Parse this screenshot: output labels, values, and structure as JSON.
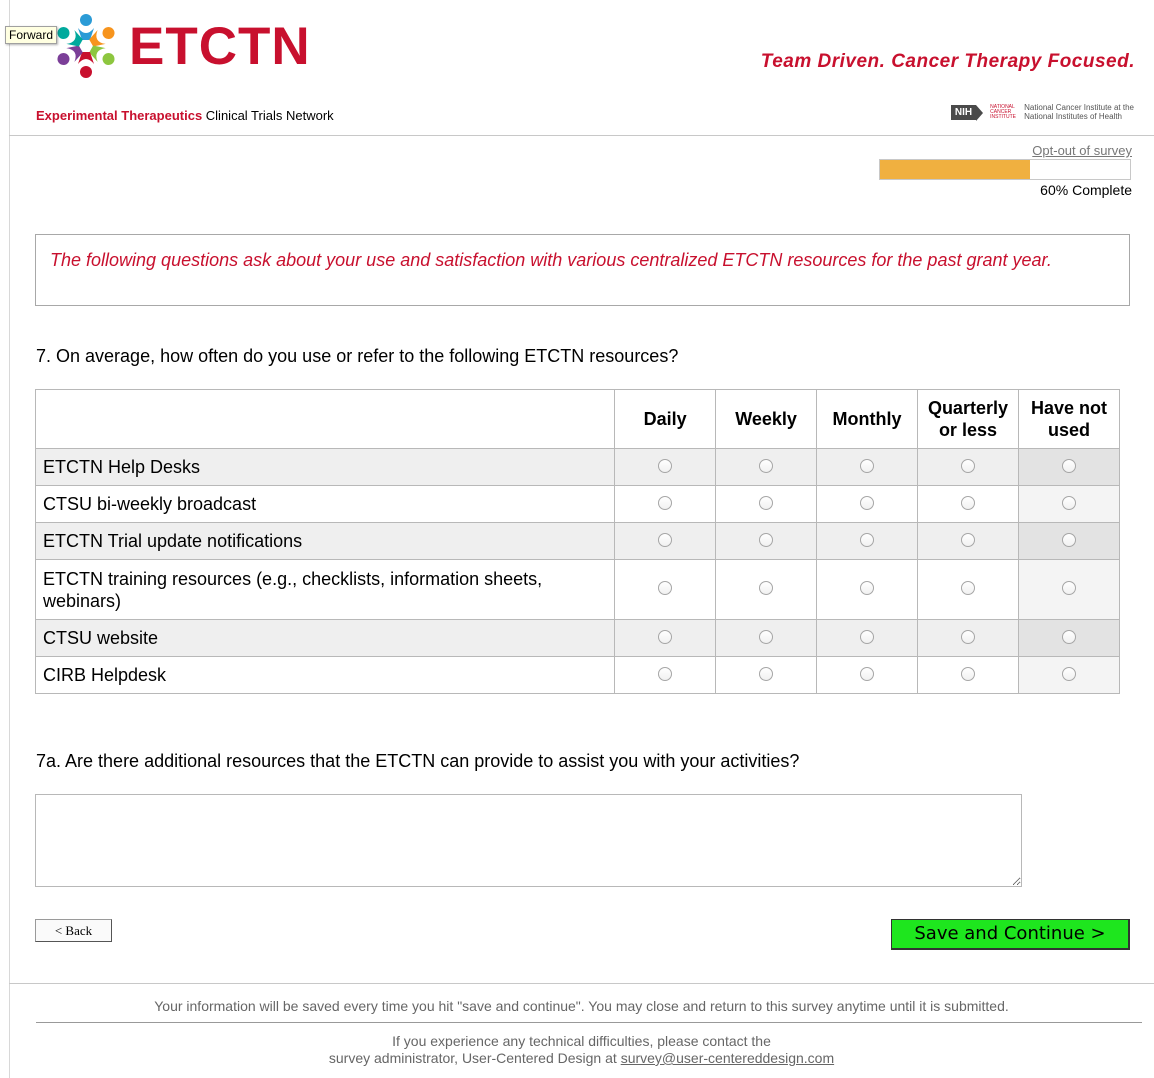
{
  "header": {
    "logo_text": "ETCTN",
    "tooltip": "Forward",
    "tagline": "Team Driven. Cancer Therapy Focused.",
    "network_red": "Experimental Therapeutics",
    "network_rest": " Clinical Trials Network",
    "nih_logo": "NIH",
    "nci_small": "NATIONAL CANCER INSTITUTE",
    "nih_line1": "National Cancer Institute at the",
    "nih_line2": "National Institutes of Health",
    "brand_color": "#c8102e"
  },
  "progress": {
    "optout": "Opt-out of survey",
    "percent": 60,
    "label": "60% Complete",
    "fill_color": "#f0b040"
  },
  "intro": "The following questions ask about your use and satisfaction with various centralized ETCTN resources for the past grant year.",
  "q7": {
    "question": "7. On average, how often do you use or refer to the following ETCTN resources?",
    "columns": [
      "Daily",
      "Weekly",
      "Monthly",
      "Quarterly or less",
      "Have not used"
    ],
    "rows": [
      "ETCTN Help Desks",
      "CTSU bi-weekly broadcast",
      "ETCTN Trial update notifications",
      "ETCTN training resources (e.g., checklists, information sheets, webinars)",
      "CTSU website",
      "CIRB Helpdesk"
    ]
  },
  "q7a": {
    "question": "7a. Are there additional resources that the ETCTN can provide to assist you with your activities?",
    "value": ""
  },
  "buttons": {
    "back": "< Back",
    "save": "Save and Continue >",
    "save_color": "#1ee61e"
  },
  "footer": {
    "save_note": "Your information will be saved every time you hit \"save and continue\". You may close and return to this survey anytime until it is submitted.",
    "contact_line1": "If you experience any technical difficulties, please contact the",
    "contact_line2": "survey administrator, User-Centered Design at ",
    "email": "survey@user-centereddesign.com"
  }
}
